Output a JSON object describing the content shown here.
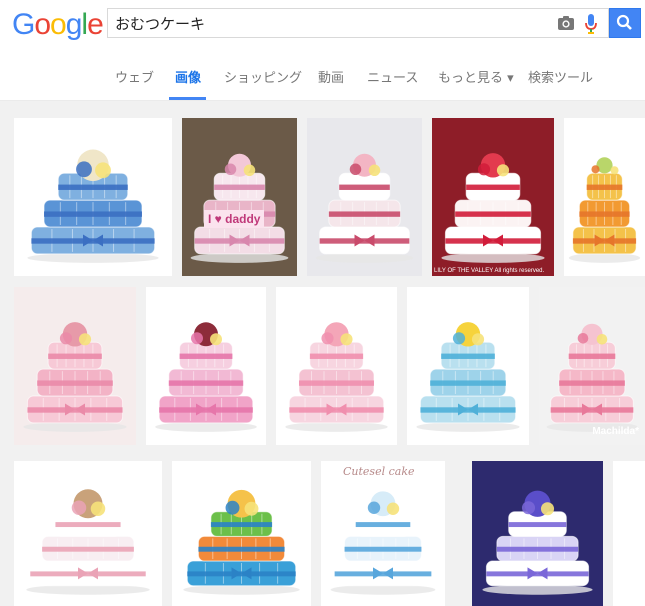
{
  "logo": {
    "letters": [
      "G",
      "o",
      "o",
      "g",
      "l",
      "e"
    ],
    "colors": [
      "#4285f4",
      "#ea4335",
      "#fbbc05",
      "#4285f4",
      "#34a853",
      "#ea4335"
    ]
  },
  "search": {
    "query": "おむつケーキ"
  },
  "tabs": [
    {
      "label": "ウェブ",
      "active": false
    },
    {
      "label": "画像",
      "active": true
    },
    {
      "label": "ショッピング",
      "active": false
    },
    {
      "label": "動画",
      "active": false
    },
    {
      "label": "ニュース",
      "active": false
    },
    {
      "label": "もっと見る ▾",
      "active": false
    },
    {
      "label": "検索ツール",
      "active": false
    }
  ],
  "colors": {
    "accent": "#4285f4",
    "active_tab": "#1a73e8",
    "tab_text": "#777777"
  },
  "images": [
    {
      "subject": "diaper-cake",
      "bg": "#ffffff",
      "tiers": [
        "#7fb0e0",
        "#5a94d6",
        "#7fb0e0"
      ],
      "ribbon": "#3b6fc2",
      "topper": "#f0e6c8",
      "caption": ""
    },
    {
      "subject": "diaper-cake",
      "bg": "#6b5a48",
      "tiers": [
        "#f3dde6",
        "#e9b5c8",
        "#f7e7ee"
      ],
      "ribbon": "#d887ad",
      "topper": "#f3c8d8",
      "caption": "I ♥ daddy"
    },
    {
      "subject": "diaper-cake",
      "bg": "#e8e8ec",
      "tiers": [
        "#ffffff",
        "#f5e6ea",
        "#ffffff"
      ],
      "ribbon": "#c94b6b",
      "topper": "#f3b5c4",
      "caption": ""
    },
    {
      "subject": "diaper-cake",
      "bg": "#8e1d28",
      "tiers": [
        "#ffffff",
        "#fbf3f3",
        "#ffffff"
      ],
      "ribbon": "#d11c3a",
      "topper": "#e33a4e",
      "caption": "LILY OF THE VALLEY All rights reserved."
    },
    {
      "subject": "diaper-cake",
      "bg": "#ffffff",
      "tiers": [
        "#f4c24a",
        "#f29a32",
        "#f4c24a"
      ],
      "ribbon": "#e6762a",
      "topper": "#b9d66a",
      "caption": ""
    },
    {
      "subject": "diaper-cake",
      "bg": "#f5ecec",
      "tiers": [
        "#f7c9d6",
        "#f3b3c6",
        "#f7c9d6"
      ],
      "ribbon": "#ea8aa8",
      "topper": "#e79aa9",
      "caption": ""
    },
    {
      "subject": "diaper-cake",
      "bg": "#ffffff",
      "tiers": [
        "#f1a4c8",
        "#f2b9d4",
        "#f6cfe0"
      ],
      "ribbon": "#e676aa",
      "topper": "#8d2c3a",
      "caption": ""
    },
    {
      "subject": "diaper-cake",
      "bg": "#ffffff",
      "tiers": [
        "#f7d5e0",
        "#f4c2d2",
        "#f7d5e0"
      ],
      "ribbon": "#f08fae",
      "topper": "#f4a6b8",
      "caption": ""
    },
    {
      "subject": "diaper-cake",
      "bg": "#ffffff",
      "tiers": [
        "#b9e0ef",
        "#9ed3ea",
        "#b9e0ef"
      ],
      "ribbon": "#4fb0d8",
      "topper": "#f6d33c",
      "caption": ""
    },
    {
      "subject": "diaper-cake",
      "bg": "#f2f2f2",
      "tiers": [
        "#f7cdd8",
        "#f5b8c8",
        "#f7cdd8"
      ],
      "ribbon": "#e8799a",
      "topper": "#f5c3d0",
      "caption": "Machilda*"
    },
    {
      "subject": "diaper-cake",
      "bg": "#ffffff",
      "tiers": [
        "#ffffff",
        "#f8eef2",
        "#ffffff"
      ],
      "ribbon": "#eaa3b6",
      "topper": "#c9a27a",
      "caption": ""
    },
    {
      "subject": "diaper-cake",
      "bg": "#ffffff",
      "tiers": [
        "#3aa0d8",
        "#f28a3a",
        "#6cc04a"
      ],
      "ribbon": "#2b82c6",
      "topper": "#f5c24a",
      "caption": ""
    },
    {
      "subject": "diaper-cake",
      "bg": "#ffffff",
      "tiers": [
        "#ffffff",
        "#e8f3fb",
        "#ffffff"
      ],
      "ribbon": "#58a6dc",
      "topper": "#d7ecf8",
      "caption": "Cutesel cake"
    },
    {
      "subject": "diaper-cake",
      "bg": "#2d2a6e",
      "tiers": [
        "#ffffff",
        "#d9d4f5",
        "#ffffff"
      ],
      "ribbon": "#7a67d8",
      "topper": "#5a4ec9",
      "caption": ""
    },
    {
      "subject": "diaper-cake",
      "bg": "#ffffff",
      "tiers": [
        "#ffffff",
        "#ffffff",
        "#ffffff"
      ],
      "ribbon": "#ffffff",
      "topper": "#ffffff",
      "caption": ""
    }
  ]
}
